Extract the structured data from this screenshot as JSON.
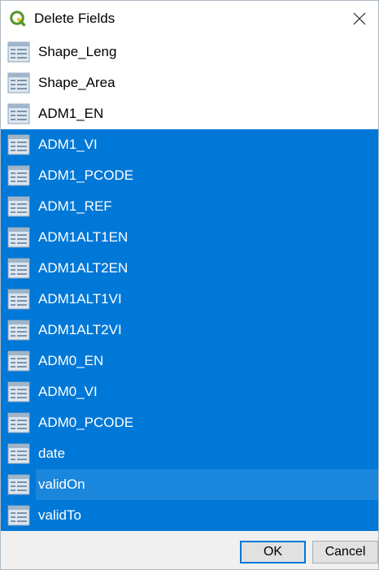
{
  "window": {
    "title": "Delete Fields",
    "icon": "qgis-logo-icon",
    "close_icon": "close-icon"
  },
  "fields": [
    {
      "name": "Shape_Leng",
      "selected": false
    },
    {
      "name": "Shape_Area",
      "selected": false
    },
    {
      "name": "ADM1_EN",
      "selected": false
    },
    {
      "name": "ADM1_VI",
      "selected": true
    },
    {
      "name": "ADM1_PCODE",
      "selected": true
    },
    {
      "name": "ADM1_REF",
      "selected": true
    },
    {
      "name": "ADM1ALT1EN",
      "selected": true
    },
    {
      "name": "ADM1ALT2EN",
      "selected": true
    },
    {
      "name": "ADM1ALT1VI",
      "selected": true
    },
    {
      "name": "ADM1ALT2VI",
      "selected": true
    },
    {
      "name": "ADM0_EN",
      "selected": true
    },
    {
      "name": "ADM0_VI",
      "selected": true
    },
    {
      "name": "ADM0_PCODE",
      "selected": true
    },
    {
      "name": "date",
      "selected": true
    },
    {
      "name": "validOn",
      "selected": true,
      "current": true
    },
    {
      "name": "validTo",
      "selected": true
    }
  ],
  "field_icon": "attribute-table-icon",
  "buttons": {
    "ok_label": "OK",
    "cancel_label": "Cancel"
  },
  "colors": {
    "selection": "#0078d7",
    "current_row": "#1a86dc",
    "qgis_green": "#589632",
    "qgis_yellow": "#f0c419"
  }
}
